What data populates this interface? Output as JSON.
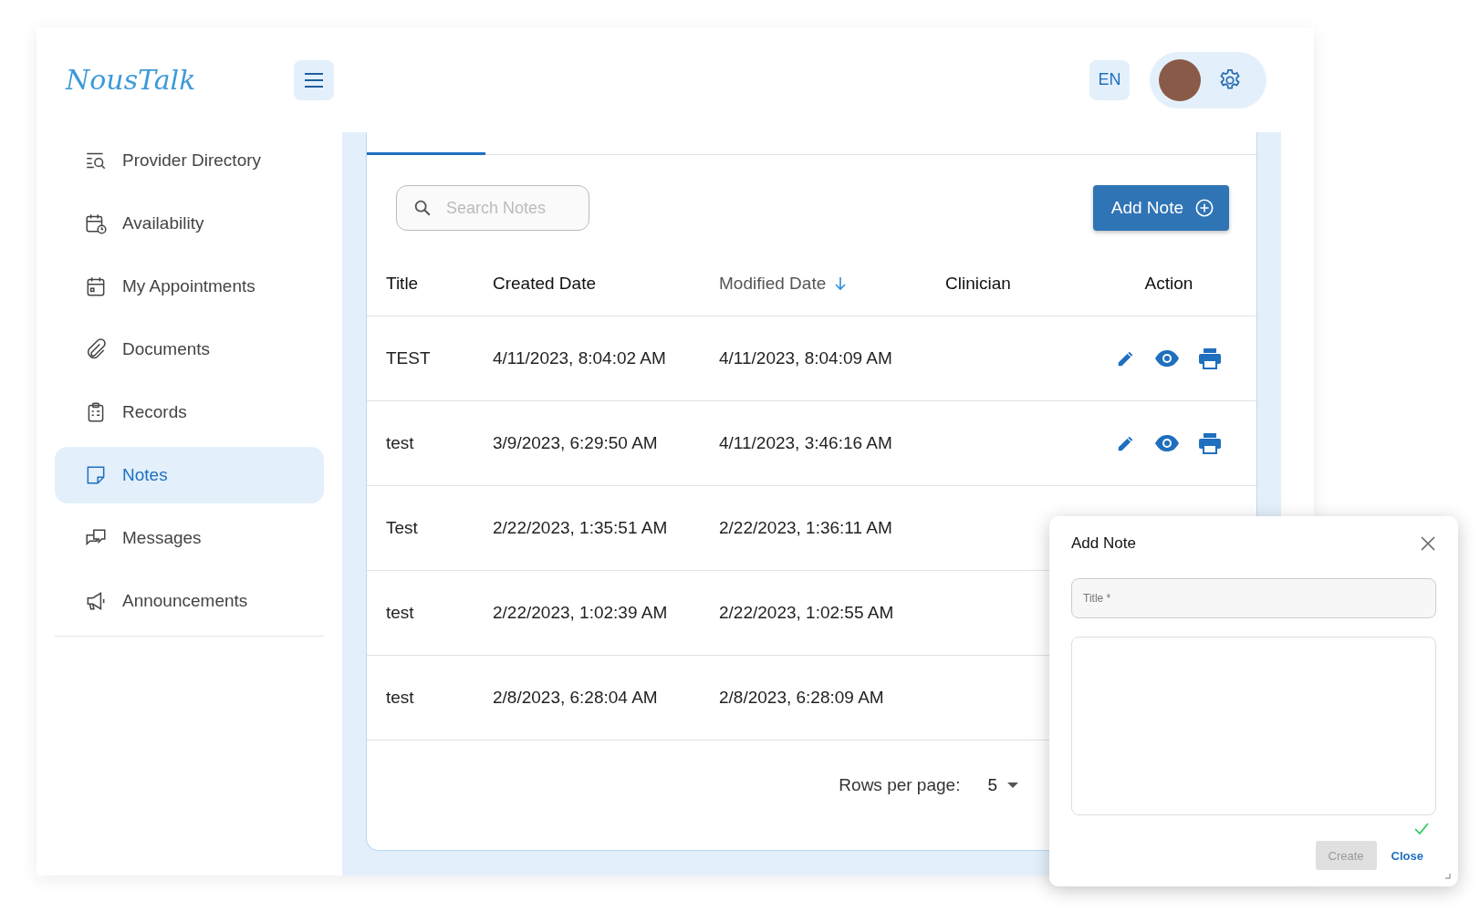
{
  "header": {
    "logo": "NousTalk",
    "language": "EN"
  },
  "sidebar": {
    "items": [
      {
        "label": "Provider Directory",
        "selected": false
      },
      {
        "label": "Availability",
        "selected": false
      },
      {
        "label": "My Appointments",
        "selected": false
      },
      {
        "label": "Documents",
        "selected": false
      },
      {
        "label": "Records",
        "selected": false
      },
      {
        "label": "Notes",
        "selected": true
      },
      {
        "label": "Messages",
        "selected": false
      },
      {
        "label": "Announcements",
        "selected": false
      }
    ]
  },
  "search": {
    "placeholder": "Search Notes"
  },
  "add_button": "Add Note",
  "table": {
    "columns": [
      {
        "label": "Title",
        "sorted": false
      },
      {
        "label": "Created Date",
        "sorted": false
      },
      {
        "label": "Modified Date",
        "sorted": true
      },
      {
        "label": "Clinician",
        "sorted": false
      },
      {
        "label": "Action",
        "sorted": false
      }
    ],
    "rows": [
      {
        "title": "TEST",
        "created": "4/11/2023, 8:04:02 AM",
        "modified": "4/11/2023, 8:04:09 AM"
      },
      {
        "title": "test",
        "created": "3/9/2023, 6:29:50 AM",
        "modified": "4/11/2023, 3:46:16 AM"
      },
      {
        "title": "Test",
        "created": "2/22/2023, 1:35:51 AM",
        "modified": "2/22/2023, 1:36:11 AM"
      },
      {
        "title": "test",
        "created": "2/22/2023, 1:02:39 AM",
        "modified": "2/22/2023, 1:02:55 AM"
      },
      {
        "title": "test",
        "created": "2/8/2023, 6:28:04 AM",
        "modified": "2/8/2023, 6:28:09 AM"
      }
    ]
  },
  "pagination": {
    "label": "Rows per page:",
    "value": "5"
  },
  "dialog": {
    "title": "Add Note",
    "title_field": {
      "placeholder": "Title *"
    },
    "valid": true,
    "create_button": {
      "label": "Create",
      "disabled": true
    },
    "close_button": "Close"
  }
}
